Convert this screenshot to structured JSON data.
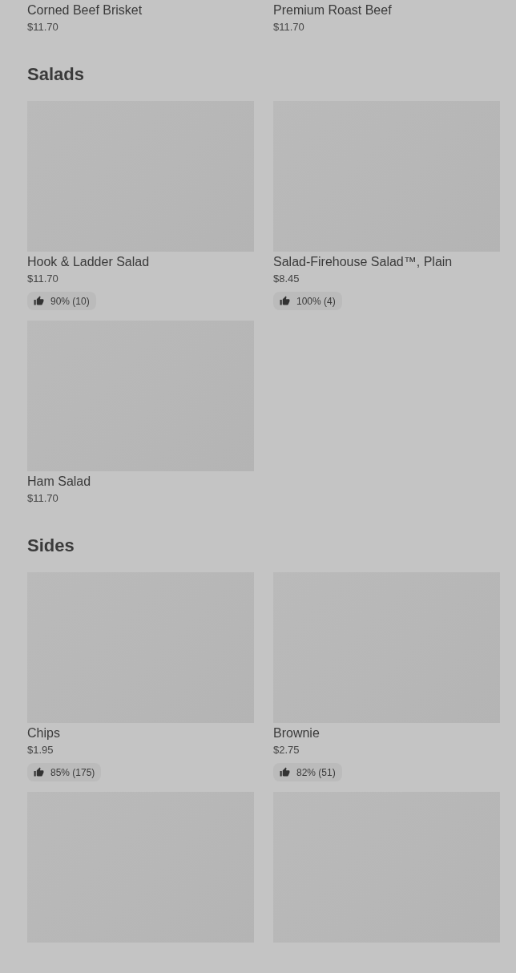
{
  "sections": [
    {
      "items": [
        {
          "kind": "text",
          "name": "Corned Beef Brisket",
          "price": "$11.70"
        },
        {
          "kind": "text",
          "name": "Premium Roast Beef",
          "price": "$11.70"
        }
      ]
    },
    {
      "title": "Salads",
      "items": [
        {
          "kind": "picture",
          "name": "Hook & Ladder Salad",
          "price": "$11.70",
          "rating": "90% (10)"
        },
        {
          "kind": "picture",
          "name": "Salad-Firehouse Salad™, Plain",
          "price": "$8.45",
          "rating": "100% (4)"
        },
        {
          "kind": "picture",
          "name": "Ham Salad",
          "price": "$11.70"
        }
      ]
    },
    {
      "title": "Sides",
      "items": [
        {
          "kind": "picture",
          "name": "Chips",
          "price": "$1.95",
          "rating": "85% (175)"
        },
        {
          "kind": "picture",
          "name": "Brownie",
          "price": "$2.75",
          "rating": "82% (51)"
        },
        {
          "kind": "picture"
        },
        {
          "kind": "picture"
        }
      ]
    }
  ]
}
